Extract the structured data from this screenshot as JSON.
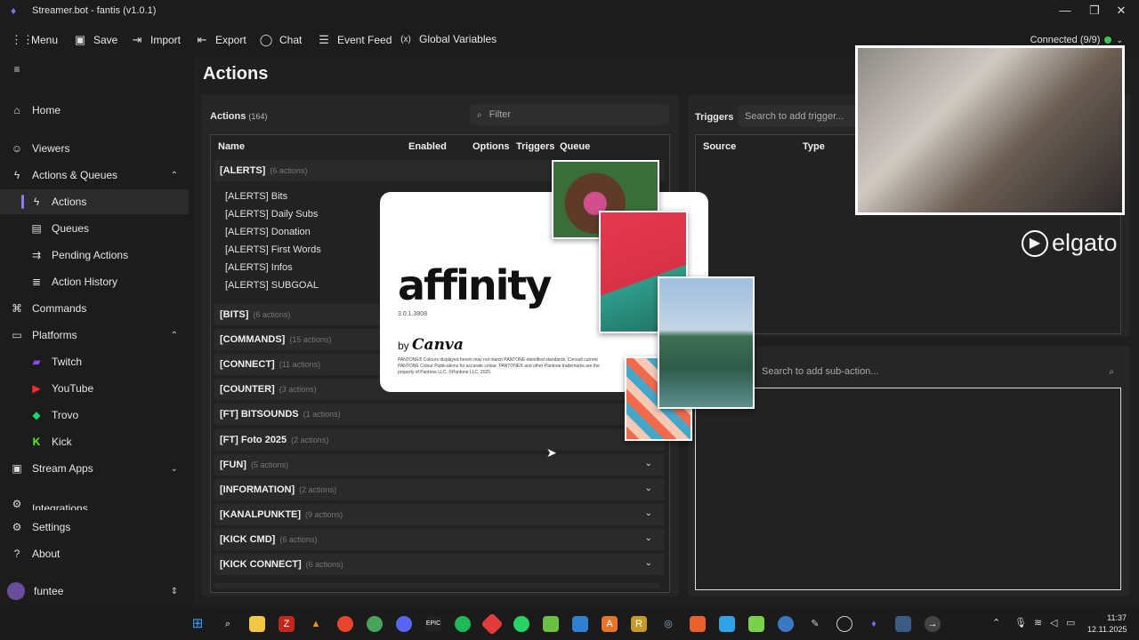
{
  "window": {
    "title": "Streamer.bot - fantis (v1.0.1)"
  },
  "toolbar": {
    "menu": "Menu",
    "save": "Save",
    "import": "Import",
    "export": "Export",
    "chat": "Chat",
    "event_feed": "Event Feed",
    "global_variables": "Global Variables",
    "connected": "Connected (9/9)"
  },
  "sidebar": {
    "home": "Home",
    "viewers": "Viewers",
    "actions_queues": "Actions & Queues",
    "actions": "Actions",
    "queues": "Queues",
    "pending_actions": "Pending Actions",
    "action_history": "Action History",
    "commands": "Commands",
    "platforms": "Platforms",
    "twitch": "Twitch",
    "youtube": "YouTube",
    "trovo": "Trovo",
    "kick": "Kick",
    "stream_apps": "Stream Apps",
    "integrations": "Integrations",
    "settings": "Settings",
    "about": "About",
    "user": "funtee"
  },
  "page": {
    "title": "Actions"
  },
  "actions_panel": {
    "label": "Actions",
    "count": "(164)",
    "filter_placeholder": "Filter",
    "columns": {
      "name": "Name",
      "enabled": "Enabled",
      "options": "Options",
      "triggers": "Triggers",
      "queue": "Queue"
    },
    "groups": [
      {
        "name": "[ALERTS]",
        "count": "(6 actions)"
      },
      {
        "name": "[BITS]",
        "count": "(6 actions)"
      },
      {
        "name": "[COMMANDS]",
        "count": "(15 actions)"
      },
      {
        "name": "[CONNECT]",
        "count": "(11 actions)"
      },
      {
        "name": "[COUNTER]",
        "count": "(3 actions)"
      },
      {
        "name": "[FT] BITSOUNDS",
        "count": "(1 actions)"
      },
      {
        "name": "[FT] Foto 2025",
        "count": "(2 actions)"
      },
      {
        "name": "[FUN]",
        "count": "(5 actions)"
      },
      {
        "name": "[INFORMATION]",
        "count": "(2 actions)"
      },
      {
        "name": "[KANALPUNKTE]",
        "count": "(9 actions)"
      },
      {
        "name": "[KICK CMD]",
        "count": "(6 actions)"
      },
      {
        "name": "[KICK CONNECT]",
        "count": "(6 actions)"
      }
    ],
    "alerts_actions": [
      "[ALERTS] Bits",
      "[ALERTS] Daily Subs",
      "[ALERTS] Donation",
      "[ALERTS] First Words",
      "[ALERTS] Infos",
      "[ALERTS] SUBGOAL"
    ]
  },
  "triggers_panel": {
    "label": "Triggers",
    "search_placeholder": "Search to add trigger...",
    "columns": {
      "source": "Source",
      "type": "Type"
    }
  },
  "subactions_panel": {
    "search_placeholder": "Search to add sub-action..."
  },
  "splash": {
    "logo": "affinity",
    "version": "3.0.1.3808",
    "by": "by",
    "brand": "Canva",
    "legal": "PANTONE® Colours displayed herein may not match PANTONE-identified standards. Consult current PANTONE Colour Publications for accurate colour. PANTONE® and other Pantone trademarks are the property of Pantone LLC. ©Pantone LLC, 2025."
  },
  "webcam": {
    "watermark": "elgato"
  },
  "taskbar": {
    "time": "11:37",
    "date": "12.11.2025"
  }
}
